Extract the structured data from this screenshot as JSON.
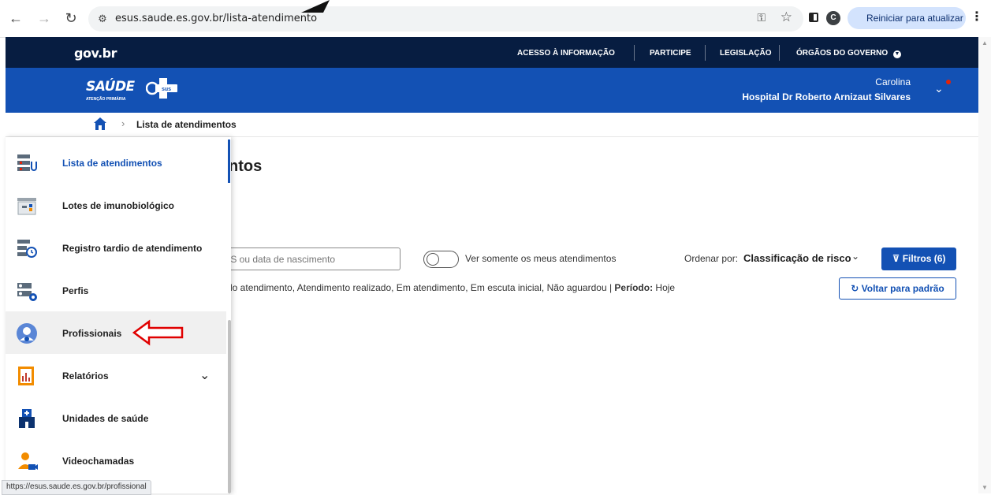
{
  "browser": {
    "url": "esus.saude.es.gov.br/lista-atendimento",
    "update_button": "Reiniciar para atualizar",
    "profile_initial": "C",
    "status_url": "https://esus.saude.es.gov.br/profissional"
  },
  "gov_bar": {
    "logo": "gov.br",
    "links": [
      "ACESSO À INFORMAÇÃO",
      "PARTICIPE",
      "LEGISLAÇÃO",
      "ÓRGÃOS DO GOVERNO"
    ]
  },
  "header": {
    "brand": "SAÚDE",
    "brand_sub": "ATENÇÃO PRIMÁRIA",
    "badge": "sus",
    "user_name": "Carolina",
    "user_unit": "Hospital Dr Roberto Arnizaut Silvares"
  },
  "breadcrumb": {
    "current": "Lista de atendimentos"
  },
  "main": {
    "title_fragment": "ntos",
    "search_placeholder": "IS ou data de nascimento",
    "toggle_label": "Ver somente os meus atendimentos",
    "order_label": "Ordenar por:",
    "order_value": "Classificação de risco",
    "filter_button": "Filtros (6)",
    "filter_summary": "do atendimento, Atendimento realizado, Em atendimento, Em escuta inicial, Não aguardou | ",
    "period_label": "Período:",
    "period_value": " Hoje",
    "reset_button": "Voltar para padrão"
  },
  "sidemenu": {
    "items": [
      {
        "label": "Lista de atendimentos",
        "icon": "clipboard-stethoscope-icon"
      },
      {
        "label": "Lotes de imunobiológico",
        "icon": "vaccine-lots-icon"
      },
      {
        "label": "Registro tardio de atendimento",
        "icon": "late-record-icon"
      },
      {
        "label": "Perfis",
        "icon": "profiles-gear-icon"
      },
      {
        "label": "Profissionais",
        "icon": "professional-user-icon"
      },
      {
        "label": "Relatórios",
        "icon": "report-chart-icon"
      },
      {
        "label": "Unidades de saúde",
        "icon": "health-unit-icon"
      },
      {
        "label": "Videochamadas",
        "icon": "video-call-icon"
      }
    ]
  },
  "colors": {
    "gov_dark": "#071d41",
    "primary_blue": "#1351b4",
    "annotation_red": "#e00000"
  }
}
